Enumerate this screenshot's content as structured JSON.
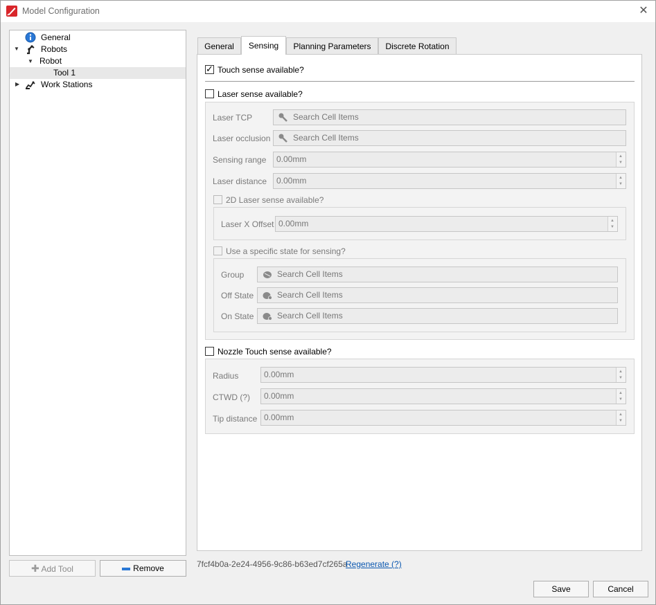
{
  "window": {
    "title": "Model Configuration"
  },
  "tree": {
    "items": [
      {
        "label": "General"
      },
      {
        "label": "Robots"
      },
      {
        "label": "Robot"
      },
      {
        "label": "Tool 1"
      },
      {
        "label": "Work Stations"
      }
    ]
  },
  "left_buttons": {
    "add_tool": "Add Tool",
    "remove": "Remove"
  },
  "tabs": [
    {
      "label": "General"
    },
    {
      "label": "Sensing"
    },
    {
      "label": "Planning Parameters"
    },
    {
      "label": "Discrete Rotation"
    }
  ],
  "sensing": {
    "touch_sense": {
      "label": "Touch sense available?",
      "checked": true
    },
    "laser_sense": {
      "label": "Laser sense available?",
      "checked": false
    },
    "laser_tcp": {
      "label": "Laser TCP",
      "placeholder": "Search Cell Items"
    },
    "laser_occlusion": {
      "label": "Laser occlusion",
      "placeholder": "Search Cell Items"
    },
    "sensing_range": {
      "label": "Sensing range",
      "value": "0.00mm"
    },
    "laser_distance": {
      "label": "Laser distance",
      "value": "0.00mm"
    },
    "laser_2d": {
      "label": "2D Laser sense available?"
    },
    "laser_x_offset": {
      "label": "Laser X Offset",
      "value": "0.00mm"
    },
    "specific_state": {
      "label": "Use a specific state for sensing?"
    },
    "group": {
      "label": "Group",
      "placeholder": "Search Cell Items"
    },
    "off_state": {
      "label": "Off State",
      "placeholder": "Search Cell Items"
    },
    "on_state": {
      "label": "On State",
      "placeholder": "Search Cell Items"
    },
    "nozzle": {
      "label": "Nozzle Touch sense available?",
      "checked": false
    },
    "radius": {
      "label": "Radius",
      "value": "0.00mm"
    },
    "ctwd": {
      "label": "CTWD (?)",
      "value": "0.00mm"
    },
    "tip_distance": {
      "label": "Tip distance",
      "value": "0.00mm"
    }
  },
  "footer": {
    "uuid": "7fcf4b0a-2e24-4956-9c86-b63ed7cf265a",
    "regenerate": "Regenerate (?)",
    "save": "Save",
    "cancel": "Cancel"
  }
}
